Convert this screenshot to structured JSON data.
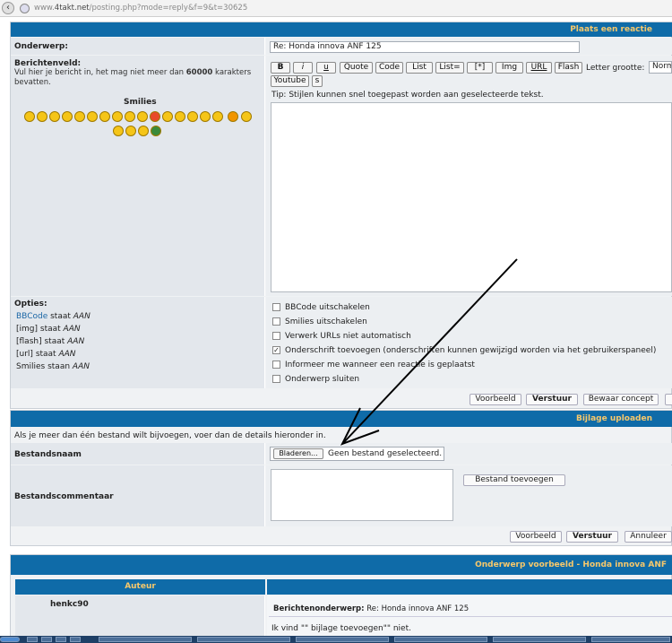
{
  "browser": {
    "url_prefix": "www.",
    "url_domain": "4takt.net",
    "url_path": "/posting.php?mode=reply&f=9&t=30625"
  },
  "reply": {
    "header": "Plaats een reactie",
    "subject_label": "Onderwerp:",
    "subject_value": "Re: Honda innova   ANF 125",
    "message_label": "Berichtenveld:",
    "message_help_pre": "Vul hier je bericht in, het mag niet meer dan ",
    "message_help_limit": "60000",
    "message_help_post": " karakters bevatten.",
    "smilies_label": "Smilies",
    "toolbar": [
      "B",
      "i",
      "u",
      "Quote",
      "Code",
      "List",
      "List=",
      "[*]",
      "Img",
      "URL",
      "Flash"
    ],
    "toolbar_row2": [
      "Youtube",
      "s"
    ],
    "fontsize_label": "Letter grootte:",
    "fontsize_value": "Norm",
    "tip": "Tip: Stijlen kunnen snel toegepast worden aan geselecteerde tekst.",
    "options_label": "Opties:",
    "options_status": [
      {
        "name": "BBCode",
        "state": "staat",
        "value": "AAN"
      },
      {
        "name": "[img]",
        "state": "staat",
        "value": "AAN"
      },
      {
        "name": "[flash]",
        "state": "staat",
        "value": "AAN"
      },
      {
        "name": "[url]",
        "state": "staat",
        "value": "AAN"
      },
      {
        "name": "Smilies",
        "state": "staan",
        "value": "AAN"
      }
    ],
    "checkboxes": [
      {
        "label": "BBCode uitschakelen",
        "checked": false
      },
      {
        "label": "Smilies uitschakelen",
        "checked": false
      },
      {
        "label": "Verwerk URLs niet automatisch",
        "checked": false
      },
      {
        "label": "Onderschrift toevoegen (onderschriften kunnen gewijzigd worden via het gebruikerspaneel)",
        "checked": true
      },
      {
        "label": "Informeer me wanneer een reactie is geplaatst",
        "checked": false
      },
      {
        "label": "Onderwerp sluiten",
        "checked": false
      }
    ],
    "buttons": {
      "preview": "Voorbeeld",
      "submit": "Verstuur",
      "draft": "Bewaar concept"
    }
  },
  "upload": {
    "header": "Bijlage uploaden",
    "info": "Als je meer dan één bestand wilt bijvoegen, voer dan de details hieronder in.",
    "filename_label": "Bestandsnaam",
    "browse_button": "Bladeren...",
    "no_file": "Geen bestand geselecteerd.",
    "comment_label": "Bestandscommentaar",
    "add_file_button": "Bestand toevoegen",
    "buttons": {
      "preview": "Voorbeeld",
      "submit": "Verstuur",
      "cancel": "Annuleer"
    }
  },
  "preview": {
    "header": "Onderwerp voorbeeld - Honda innova ANF",
    "author_col": "Auteur",
    "author": "henkc90",
    "subject_label": "Berichtenonderwerp:",
    "subject": "Re: Honda innova ANF 125",
    "body": "Ik vind \"\" bijlage toevoegen\"\" niet."
  },
  "colors": {
    "header_bg": "#0f6ba8",
    "header_text": "#f7c86b",
    "link": "#1b67a6"
  }
}
